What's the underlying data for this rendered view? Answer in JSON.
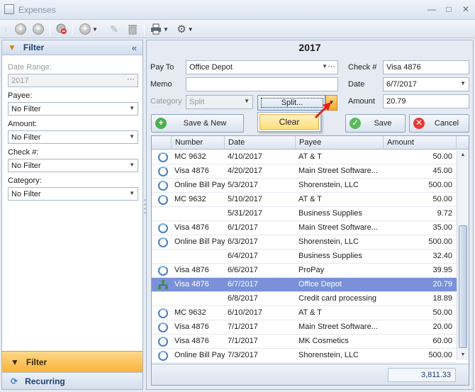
{
  "window": {
    "title": "Expenses"
  },
  "filter_panel": {
    "header": "Filter",
    "date_range_label": "Date Range:",
    "date_range_value": "2017",
    "payee_label": "Payee:",
    "payee_value": "No Filter",
    "amount_label": "Amount:",
    "amount_value": "No Filter",
    "check_label": "Check #:",
    "check_value": "No Filter",
    "category_label": "Category:",
    "category_value": "No Filter",
    "tab_filter": "Filter",
    "tab_recurring": "Recurring"
  },
  "form": {
    "year": "2017",
    "pay_to_label": "Pay To",
    "pay_to_value": "Office Depot",
    "memo_label": "Memo",
    "memo_value": "",
    "category_label": "Category",
    "category_value": "Split",
    "split_button": "Split...",
    "clear_item": "Clear",
    "check_label": "Check #",
    "check_value": "Visa 4876",
    "date_label": "Date",
    "date_value": "6/7/2017",
    "amount_label": "Amount",
    "amount_value": "20.79",
    "save_new": "Save & New",
    "save": "Save",
    "cancel": "Cancel"
  },
  "grid": {
    "columns": [
      "Number",
      "Date",
      "Payee",
      "Amount"
    ],
    "rows": [
      {
        "icon": "recurring",
        "number": "MC 9632",
        "date": "4/10/2017",
        "payee": "AT & T",
        "amount": "50.00"
      },
      {
        "icon": "recurring",
        "number": "Visa 4876",
        "date": "4/20/2017",
        "payee": "Main Street Software...",
        "amount": "45.00"
      },
      {
        "icon": "recurring",
        "number": "Online Bill Pay",
        "date": "5/3/2017",
        "payee": "Shorenstein, LLC",
        "amount": "500.00"
      },
      {
        "icon": "recurring",
        "number": "MC 9632",
        "date": "5/10/2017",
        "payee": "AT & T",
        "amount": "50.00"
      },
      {
        "icon": "",
        "number": "",
        "date": "5/31/2017",
        "payee": "Business Supplies",
        "amount": "9.72"
      },
      {
        "icon": "recurring",
        "number": "Visa 4876",
        "date": "6/1/2017",
        "payee": "Main Street Software...",
        "amount": "35.00"
      },
      {
        "icon": "recurring",
        "number": "Online Bill Pay",
        "date": "6/3/2017",
        "payee": "Shorenstein, LLC",
        "amount": "500.00"
      },
      {
        "icon": "",
        "number": "",
        "date": "6/4/2017",
        "payee": "Business Supplies",
        "amount": "32.40"
      },
      {
        "icon": "recurring",
        "number": "Visa 4876",
        "date": "6/6/2017",
        "payee": "ProPay",
        "amount": "39.95"
      },
      {
        "icon": "split",
        "number": "Visa 4876",
        "date": "6/7/2017",
        "payee": "Office Depot",
        "amount": "20.79",
        "selected": true
      },
      {
        "icon": "",
        "number": "",
        "date": "6/8/2017",
        "payee": "Credit card processing",
        "amount": "18.89"
      },
      {
        "icon": "recurring",
        "number": "MC 9632",
        "date": "6/10/2017",
        "payee": "AT & T",
        "amount": "50.00"
      },
      {
        "icon": "recurring",
        "number": "Visa 4876",
        "date": "7/1/2017",
        "payee": "Main Street Software...",
        "amount": "20.00"
      },
      {
        "icon": "recurring",
        "number": "Visa 4876",
        "date": "7/1/2017",
        "payee": "MK Cosmetics",
        "amount": "60.00"
      },
      {
        "icon": "recurring",
        "number": "Online Bill Pay",
        "date": "7/3/2017",
        "payee": "Shorenstein, LLC",
        "amount": "500.00"
      }
    ],
    "total": "3,811.33"
  },
  "colors": {
    "selected_row": "#7a91d9",
    "active_tab": "#f9b23a",
    "accent_blue": "#1d3f72"
  }
}
